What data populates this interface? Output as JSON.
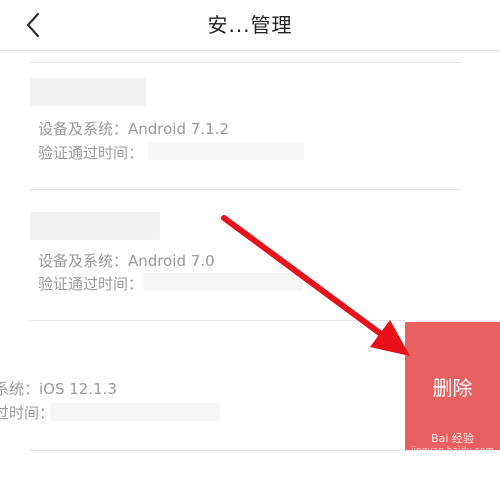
{
  "nav": {
    "title": "安...管理",
    "back_icon": "chevron-left-icon"
  },
  "devices": [
    {
      "system_label": "设备及系统：Android 7.1.2",
      "verify_label": "验证通过时间："
    },
    {
      "system_label": "设备及系统：Android 7.0",
      "verify_label": "验证通过时间："
    },
    {
      "system_label": "系统：iOS 12.1.3",
      "verify_label": "过时间："
    }
  ],
  "swipe_action": {
    "delete_label": "删除",
    "color": "#e8605f"
  },
  "annotation": {
    "arrow_color": "#e8111a"
  },
  "watermark": {
    "line1": "Bai 经验",
    "line2": "jingyan.baidu.com"
  }
}
